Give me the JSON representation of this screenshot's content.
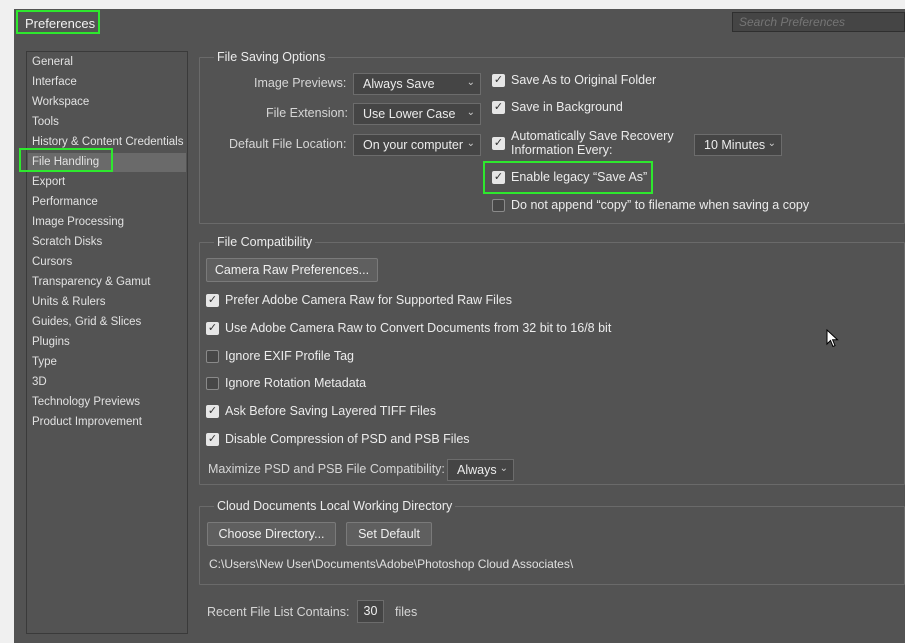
{
  "window": {
    "title": "Preferences"
  },
  "search": {
    "placeholder": "Search Preferences"
  },
  "sidebar": {
    "items": [
      {
        "label": "General"
      },
      {
        "label": "Interface"
      },
      {
        "label": "Workspace"
      },
      {
        "label": "Tools"
      },
      {
        "label": "History & Content Credentials"
      },
      {
        "label": "File Handling",
        "selected": true
      },
      {
        "label": "Export"
      },
      {
        "label": "Performance"
      },
      {
        "label": "Image Processing"
      },
      {
        "label": "Scratch Disks"
      },
      {
        "label": "Cursors"
      },
      {
        "label": "Transparency & Gamut"
      },
      {
        "label": "Units & Rulers"
      },
      {
        "label": "Guides, Grid & Slices"
      },
      {
        "label": "Plugins"
      },
      {
        "label": "Type"
      },
      {
        "label": "3D"
      },
      {
        "label": "Technology Previews"
      },
      {
        "label": "Product Improvement"
      }
    ]
  },
  "file_saving": {
    "title": "File Saving Options",
    "image_previews_label": "Image Previews:",
    "image_previews_value": "Always Save",
    "file_extension_label": "File Extension:",
    "file_extension_value": "Use Lower Case",
    "default_location_label": "Default File Location:",
    "default_location_value": "On your computer",
    "save_original_folder": "Save As to Original Folder",
    "save_background": "Save in Background",
    "auto_save_line1": "Automatically Save Recovery",
    "auto_save_line2": "Information Every:",
    "auto_save_interval": "10 Minutes",
    "legacy_save_as": "Enable legacy “Save As”",
    "no_append_copy": "Do not append “copy” to filename when saving a copy"
  },
  "file_compat": {
    "title": "File Compatibility",
    "camera_raw_button": "Camera Raw Preferences...",
    "prefer_acr": "Prefer Adobe Camera Raw for Supported Raw Files",
    "use_acr_convert": "Use Adobe Camera Raw to Convert Documents from 32 bit to 16/8 bit",
    "ignore_exif": "Ignore EXIF Profile Tag",
    "ignore_rotation": "Ignore Rotation Metadata",
    "ask_tiff": "Ask Before Saving Layered TIFF Files",
    "disable_compression": "Disable Compression of PSD and PSB Files",
    "maximize_label": "Maximize PSD and PSB File Compatibility:",
    "maximize_value": "Always"
  },
  "cloud_docs": {
    "title": "Cloud Documents Local Working Directory",
    "choose_button": "Choose Directory...",
    "set_default_button": "Set Default",
    "path": "C:\\Users\\New User\\Documents\\Adobe\\Photoshop Cloud Associates\\"
  },
  "recent": {
    "label": "Recent File List Contains:",
    "value": "30",
    "suffix": "files"
  },
  "colors": {
    "panel": "#535353",
    "highlight": "#2ee82e",
    "selected_item": "#6a6a6a"
  }
}
